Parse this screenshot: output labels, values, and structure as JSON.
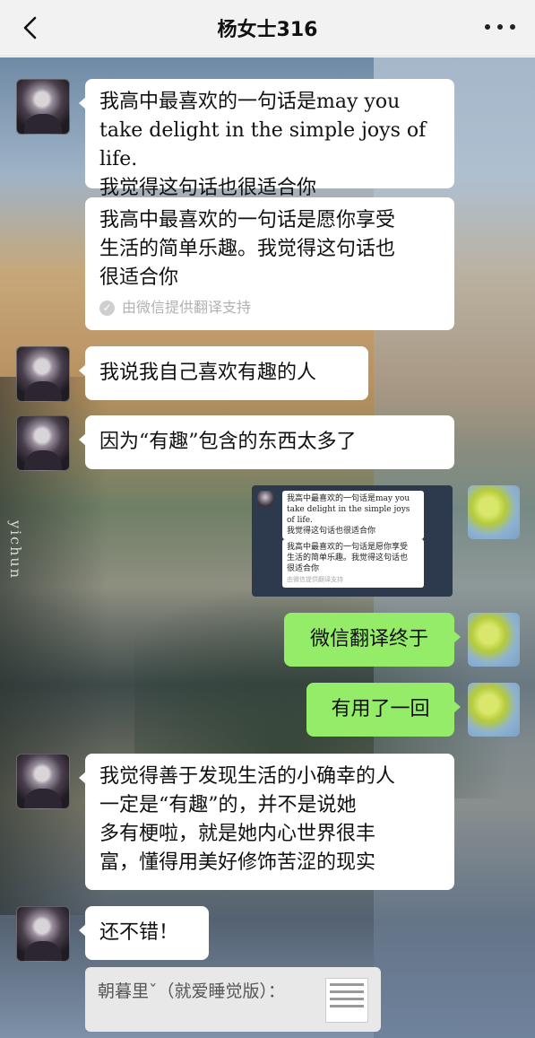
{
  "header": {
    "title": "杨女士316"
  },
  "messages": {
    "m1": {
      "line1": "我高中最喜欢的一句话是may you",
      "line2": "take delight in the simple joys of life.",
      "line3": "我觉得这句话也很适合你"
    },
    "m1_translation": {
      "line1": "我高中最喜欢的一句话是愿你享受",
      "line2": "生活的简单乐趣。我觉得这句话也",
      "line3": "很适合你",
      "note": "由微信提供翻译支持"
    },
    "m2": "我说我自己喜欢有趣的人",
    "m3": "因为“有趣”包含的东西太多了",
    "screenshot": {
      "q1": "我高中最喜欢的一句话是may you",
      "q2": "take delight in the simple joys of life.",
      "q3": "我觉得这句话也很适合你",
      "t1": "我高中最喜欢的一句话是愿你享受",
      "t2": "生活的简单乐趣。我觉得这句话也",
      "t3": "很适合你",
      "tn": "由微信提供翻译支持"
    },
    "mine1": "微信翻译终于",
    "mine2": "有用了一回",
    "m4": {
      "line1": "我觉得善于发现生活的小确幸的人",
      "line2": "一定是“有趣”的，并不是说她",
      "line3": "多有梗啦，就是她内心世界很丰",
      "line4": "富，懂得用美好修饰苦涩的现实"
    },
    "m5": "还不错！",
    "quote": "朝暮里ˇ（就爱睡觉版）："
  },
  "watermark": "yichun",
  "colors": {
    "self_bubble": "#95ec69",
    "other_bubble": "#ffffff",
    "header_bg": "#f2f2f2"
  },
  "icons": {
    "back": "chevron-left-icon",
    "more": "more-dots-icon",
    "check": "check-circle-icon"
  }
}
